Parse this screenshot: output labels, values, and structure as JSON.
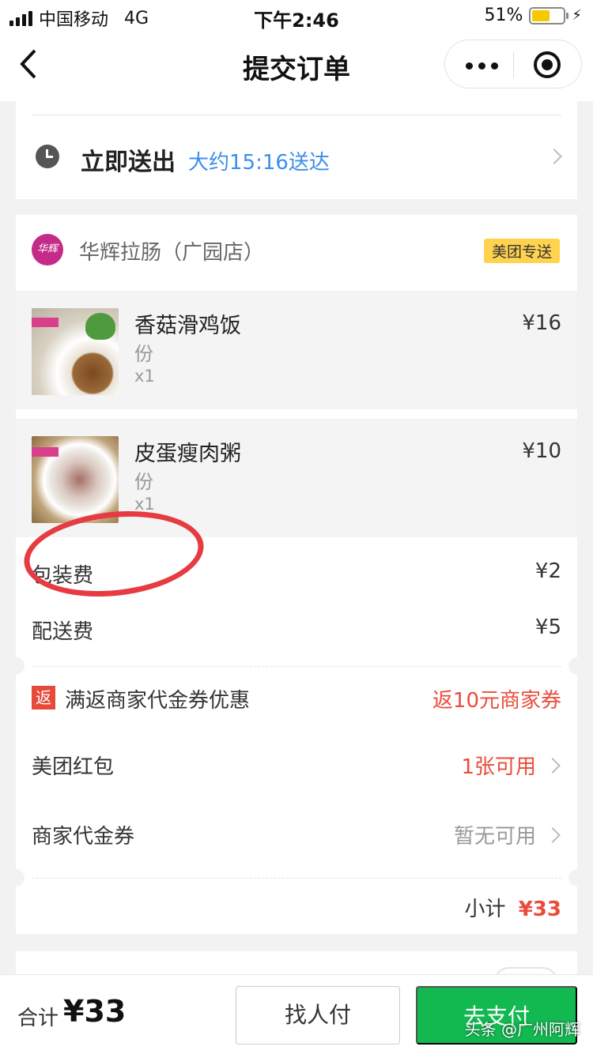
{
  "status_bar": {
    "carrier": "中国移动",
    "network": "4G",
    "time": "下午2:46",
    "battery": "51%",
    "battery_level": 0.51
  },
  "nav": {
    "title": "提交订单"
  },
  "delivery": {
    "label": "立即送出",
    "estimate": "大约15:16送达"
  },
  "shop": {
    "logo_text": "华辉",
    "name": "华辉拉肠（广园店）",
    "badge": "美团专送"
  },
  "items": [
    {
      "name": "香菇滑鸡饭",
      "unit": "份",
      "qty": "x1",
      "price": "¥16"
    },
    {
      "name": "皮蛋瘦肉粥",
      "unit": "份",
      "qty": "x1",
      "price": "¥10"
    }
  ],
  "fees": {
    "packaging_label": "包装费",
    "packaging_value": "¥2",
    "delivery_label": "配送费",
    "delivery_value": "¥5"
  },
  "promotions": {
    "rebate_icon": "返",
    "rebate_label": "满返商家代金券优惠",
    "rebate_value": "返10元商家券",
    "red_packet_label": "美团红包",
    "red_packet_value": "1张可用",
    "voucher_label": "商家代金券",
    "voucher_value": "暂无可用"
  },
  "subtotal": {
    "label": "小计",
    "value": "¥33"
  },
  "bottom_bar": {
    "total_label": "合计",
    "total_value": "¥33",
    "friend_pay": "找人付",
    "pay": "去支付",
    "watermark": "头条 @广州阿辉"
  },
  "colors": {
    "accent_blue": "#3b8ee8",
    "price_red": "#ea4c3b",
    "pay_green": "#12b951",
    "badge_yellow": "#ffd34e"
  }
}
